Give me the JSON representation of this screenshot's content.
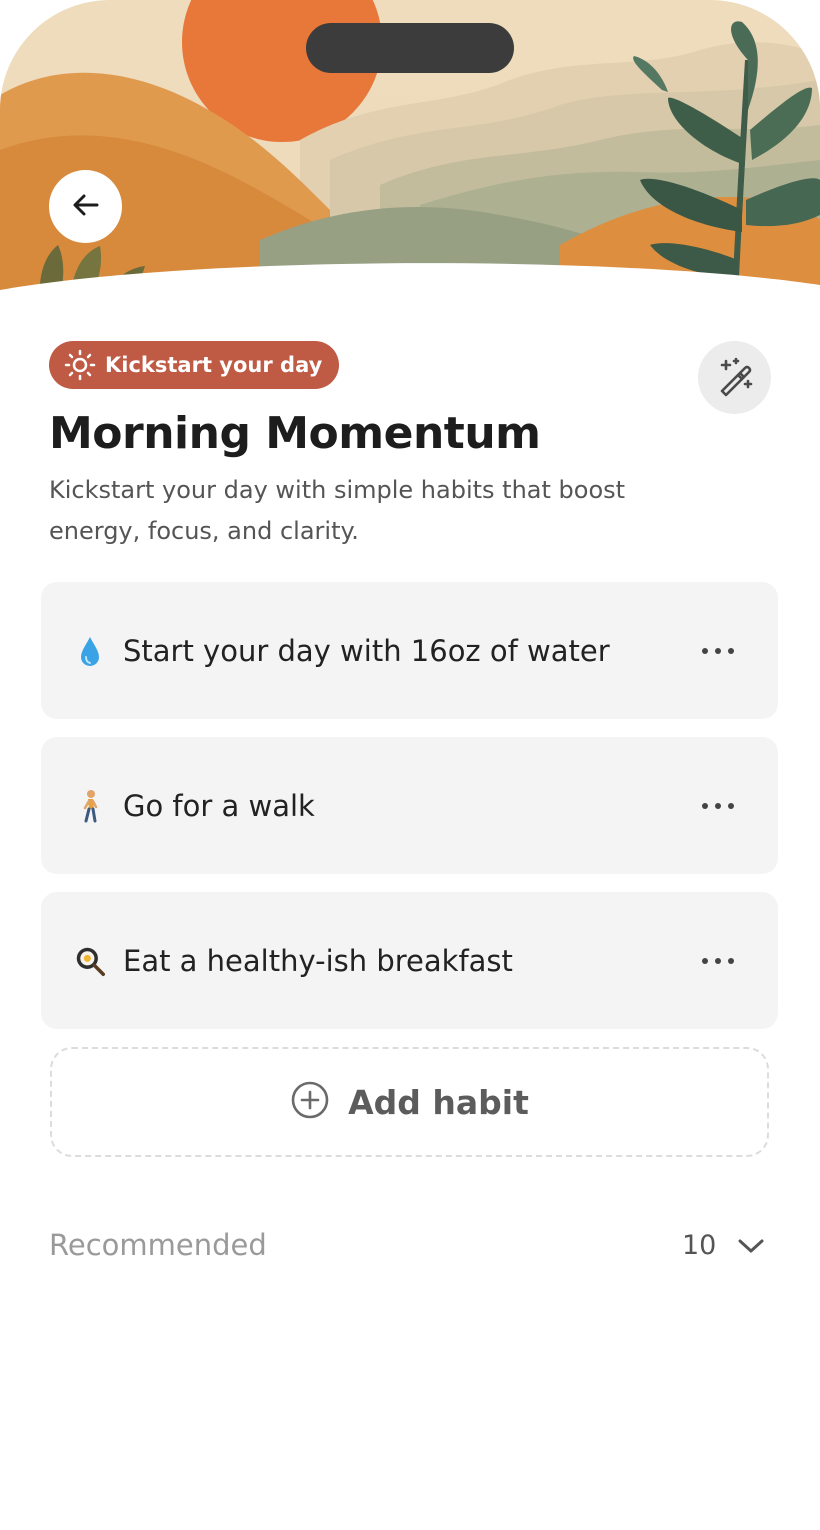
{
  "header": {
    "back_icon": "arrow-left-icon",
    "illustration": "landscape-sunrise-illustration"
  },
  "tag": {
    "icon": "sun-icon",
    "label": "Kickstart your day"
  },
  "edit_icon": "magic-wand-icon",
  "title": "Morning Momentum",
  "subtitle": "Kickstart your day with simple habits that boost energy, focus, and clarity.",
  "habits": [
    {
      "emoji": "water-droplet-icon",
      "label": "Start your day with 16oz of water",
      "menu_icon": "more-horizontal-icon"
    },
    {
      "emoji": "person-walking-icon",
      "label": "Go for a walk",
      "menu_icon": "more-horizontal-icon"
    },
    {
      "emoji": "frying-pan-egg-icon",
      "label": "Eat a healthy-ish breakfast",
      "menu_icon": "more-horizontal-icon"
    }
  ],
  "add_habit": {
    "icon": "plus-circle-icon",
    "label": "Add habit"
  },
  "recommended": {
    "label": "Recommended",
    "count": "10",
    "toggle_icon": "chevron-down-icon"
  },
  "colors": {
    "tag_bg": "#bf5a45",
    "card_bg": "#f4f4f4",
    "title": "#1d1d1d",
    "sun": "#e87634"
  }
}
